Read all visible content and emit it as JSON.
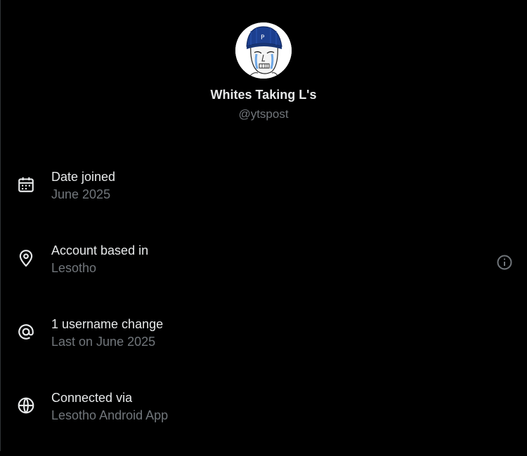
{
  "profile": {
    "display_name": "Whites Taking L's",
    "handle": "@ytspost",
    "avatar_icon": "crying-wojak-avatar"
  },
  "info_rows": [
    {
      "icon": "calendar-icon",
      "title": "Date joined",
      "subtitle": "June 2025"
    },
    {
      "icon": "location-pin-icon",
      "title": "Account based in",
      "subtitle": "Lesotho",
      "action_icon": "info-icon"
    },
    {
      "icon": "at-sign-icon",
      "title": "1 username change",
      "subtitle": "Last on June 2025"
    },
    {
      "icon": "globe-icon",
      "title": "Connected via",
      "subtitle": "Lesotho Android App"
    }
  ],
  "colors": {
    "background": "#000000",
    "primary_text": "#e7e9ea",
    "secondary_text": "#71767b",
    "avatar_hat": "#1c3f8f"
  }
}
